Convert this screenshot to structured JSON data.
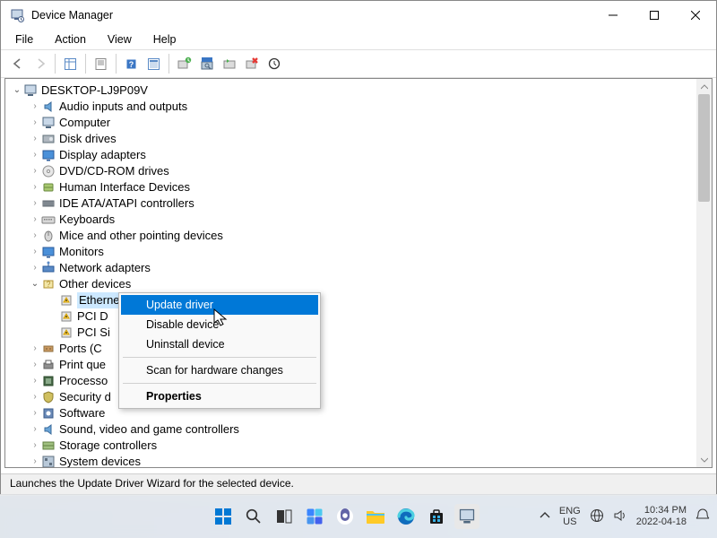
{
  "window": {
    "title": "Device Manager",
    "menus": [
      "File",
      "Action",
      "View",
      "Help"
    ]
  },
  "tree": {
    "root": "DESKTOP-LJ9P09V",
    "categories": [
      {
        "label": "Audio inputs and outputs",
        "icon": "audio"
      },
      {
        "label": "Computer",
        "icon": "computer"
      },
      {
        "label": "Disk drives",
        "icon": "disk"
      },
      {
        "label": "Display adapters",
        "icon": "display"
      },
      {
        "label": "DVD/CD-ROM drives",
        "icon": "cd"
      },
      {
        "label": "Human Interface Devices",
        "icon": "hid"
      },
      {
        "label": "IDE ATA/ATAPI controllers",
        "icon": "ide"
      },
      {
        "label": "Keyboards",
        "icon": "keyboard"
      },
      {
        "label": "Mice and other pointing devices",
        "icon": "mouse"
      },
      {
        "label": "Monitors",
        "icon": "monitor"
      },
      {
        "label": "Network adapters",
        "icon": "network"
      }
    ],
    "other": {
      "label": "Other devices",
      "children": [
        {
          "label": "Ethernet Controller"
        },
        {
          "label": "PCI Device"
        },
        {
          "label": "PCI Simple Communications Controller"
        }
      ]
    },
    "after": [
      {
        "label": "Ports (COM & LPT)",
        "icon": "port"
      },
      {
        "label": "Print queues",
        "icon": "printer"
      },
      {
        "label": "Processors",
        "icon": "cpu"
      },
      {
        "label": "Security devices",
        "icon": "security"
      },
      {
        "label": "Software devices",
        "icon": "software"
      },
      {
        "label": "Sound, video and game controllers",
        "icon": "audio"
      },
      {
        "label": "Storage controllers",
        "icon": "storage"
      },
      {
        "label": "System devices",
        "icon": "system"
      }
    ]
  },
  "context_menu": {
    "items": [
      "Update driver",
      "Disable device",
      "Uninstall device"
    ],
    "scan": "Scan for hardware changes",
    "properties": "Properties"
  },
  "status": "Launches the Update Driver Wizard for the selected device.",
  "taskbar": {
    "lang1": "ENG",
    "lang2": "US",
    "time": "10:34 PM",
    "date": "2022-04-18"
  }
}
